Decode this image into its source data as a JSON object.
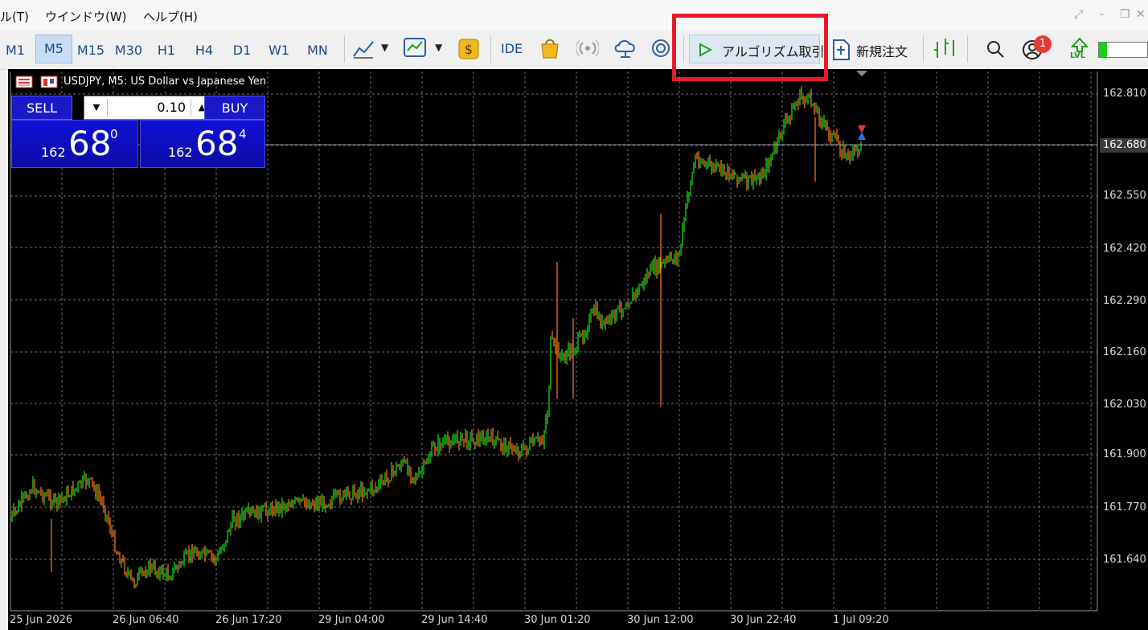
{
  "menu": {
    "partial_left": "ル(T)",
    "window": "ウインドウ(W)",
    "help": "ヘルプ(H)"
  },
  "timeframes": [
    {
      "label": "M1",
      "active": false
    },
    {
      "label": "M5",
      "active": true
    },
    {
      "label": "M15",
      "active": false
    },
    {
      "label": "M30",
      "active": false
    },
    {
      "label": "H1",
      "active": false
    },
    {
      "label": "H4",
      "active": false
    },
    {
      "label": "D1",
      "active": false
    },
    {
      "label": "W1",
      "active": false
    },
    {
      "label": "MN",
      "active": false
    }
  ],
  "toolbar": {
    "ide_label": "IDE",
    "algo_trading_label": "アルゴリズム取引",
    "new_order_label": "新規注文",
    "notification_count": "1",
    "lvl_label": "LVL"
  },
  "chart": {
    "title": "USDJPY, M5:  US Dollar vs Japanese Yen",
    "current_price": "162.680",
    "price_labels": [
      "162.810",
      "162.550",
      "162.420",
      "162.290",
      "162.160",
      "162.030",
      "161.900",
      "161.770",
      "161.640"
    ],
    "time_labels": [
      "25 Jun 2026",
      "26 Jun 06:40",
      "26 Jun 17:20",
      "29 Jun 04:00",
      "29 Jun 14:40",
      "30 Jun 01:20",
      "30 Jun 12:00",
      "30 Jun 22:40",
      "1 Jul 09:20"
    ]
  },
  "trade": {
    "sell_label": "SELL",
    "buy_label": "BUY",
    "volume": "0.10",
    "sell_prefix": "162",
    "sell_main": "68",
    "sell_sup": "0",
    "buy_prefix": "162",
    "buy_main": "68",
    "buy_sup": "4"
  },
  "colors": {
    "bull": "#19e619",
    "bear": "#ff7f1a",
    "highlight": "#e8192b",
    "panel": "#1919c8"
  },
  "icons": [
    "line-chart-icon",
    "indicator-chart-icon",
    "dollar-icon",
    "market-bag-icon",
    "signals-icon",
    "vps-cloud-icon",
    "search-icon",
    "user-icon",
    "level-icon"
  ]
}
